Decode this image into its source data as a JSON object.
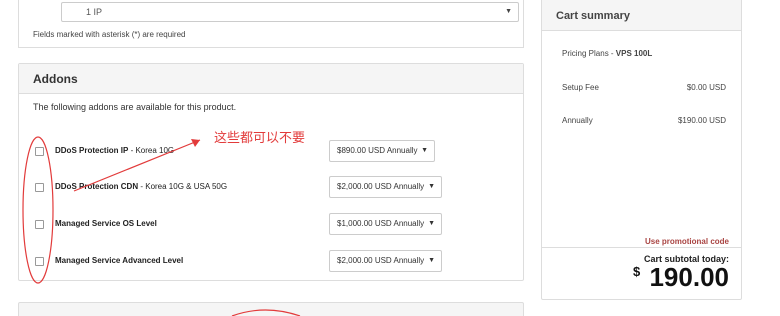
{
  "product_config": {
    "ip_option": "1 IP",
    "required_note": "Fields marked with asterisk (*) are required"
  },
  "addons": {
    "title": "Addons",
    "intro": "The following addons are available for this product.",
    "items": [
      {
        "name": "DDoS Protection IP",
        "suffix": " - Korea 10G",
        "price": "$890.00 USD Annually"
      },
      {
        "name": "DDoS Protection CDN",
        "suffix": " - Korea 10G & USA 50G",
        "price": "$2,000.00 USD Annually"
      },
      {
        "name": "Managed Service OS Level",
        "suffix": "",
        "price": "$1,000.00 USD Annually"
      },
      {
        "name": "Managed Service Advanced Level",
        "suffix": "",
        "price": "$2,000.00 USD Annually"
      }
    ],
    "dropdown_arrow": "▼"
  },
  "cart": {
    "title": "Cart summary",
    "plan_prefix": "Pricing Plans - ",
    "plan_name": "VPS 100L",
    "lines": [
      {
        "label": "Setup Fee",
        "value": "$0.00 USD"
      },
      {
        "label": "Annually",
        "value": "$190.00 USD"
      }
    ],
    "promo_link": "Use promotional code",
    "subtotal_label": "Cart subtotal today:",
    "subtotal_currency": "$",
    "subtotal_amount": "190.00"
  },
  "annotation": {
    "note": "这些都可以不要",
    "color": "#e23b3b"
  },
  "colors": {
    "panel_header_bg": "#f5f5f5",
    "border": "#dddddd",
    "promo_link": "#a94442"
  }
}
